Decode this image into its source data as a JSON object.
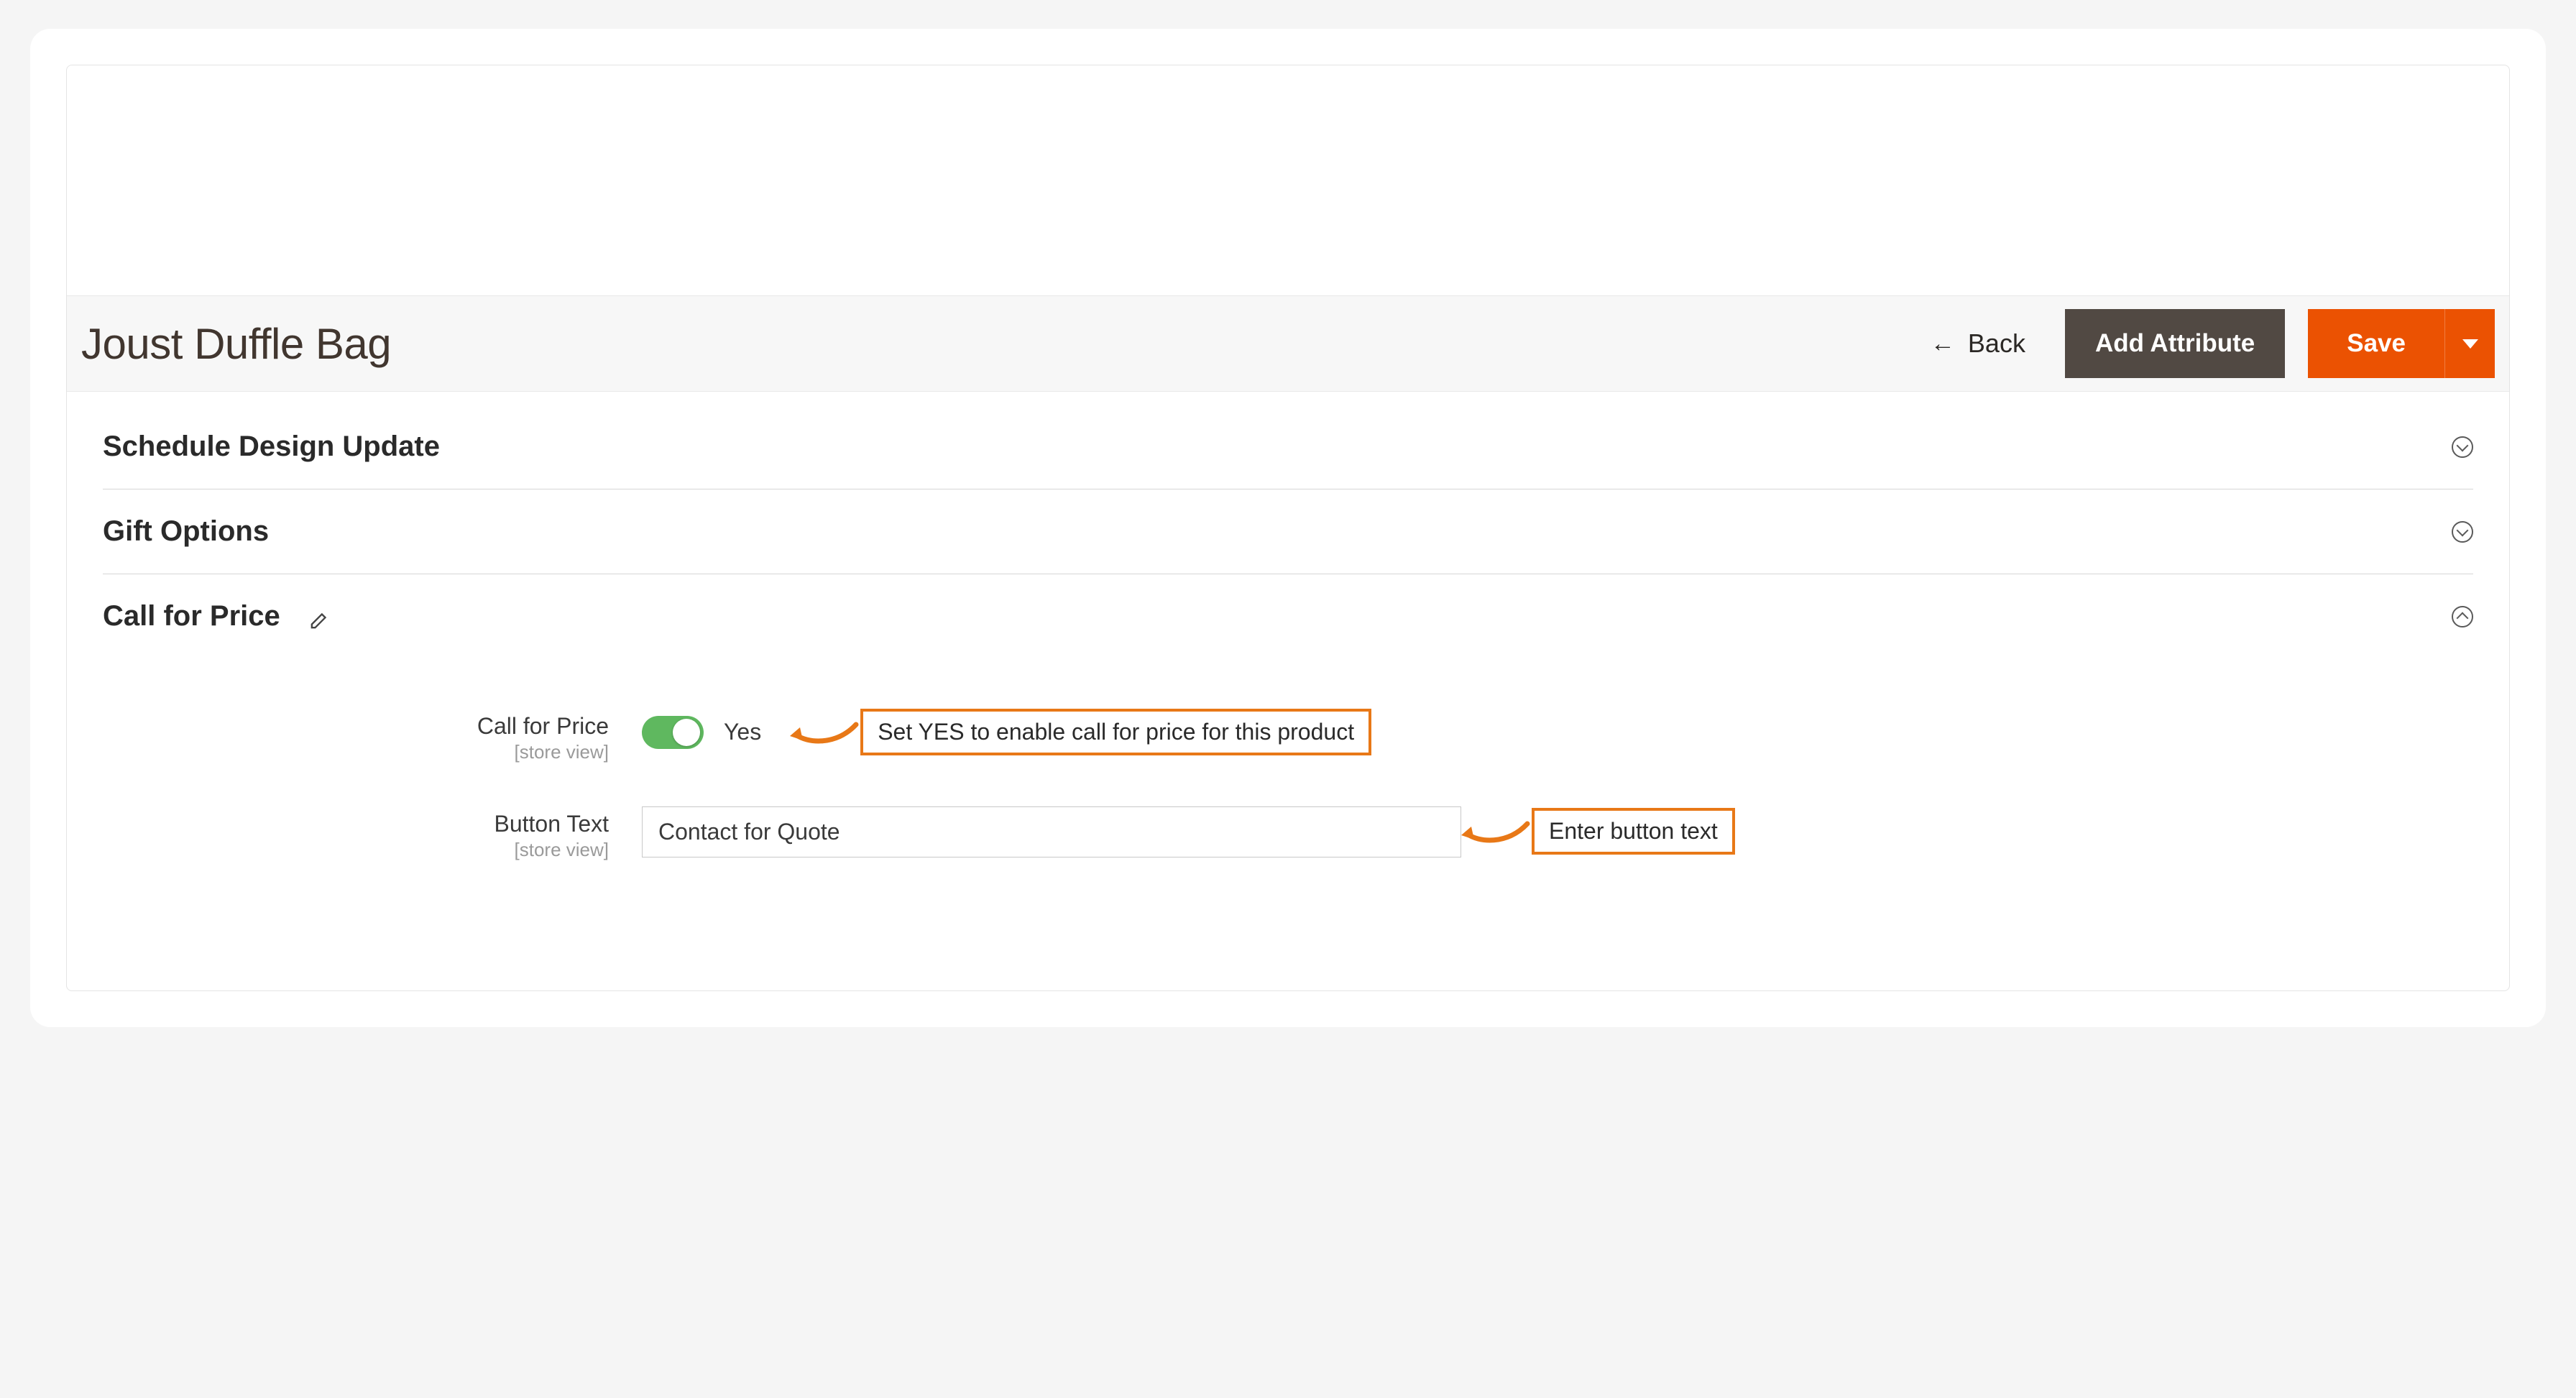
{
  "header": {
    "title": "Joust Duffle Bag",
    "back_label": "Back",
    "add_attribute_label": "Add Attribute",
    "save_label": "Save"
  },
  "sections": {
    "schedule_design_update": "Schedule Design Update",
    "gift_options": "Gift Options",
    "call_for_price": "Call for Price"
  },
  "fields": {
    "call_for_price": {
      "label": "Call for Price",
      "scope": "[store view]",
      "value_label": "Yes"
    },
    "button_text": {
      "label": "Button Text",
      "scope": "[store view]",
      "value": "Contact for Quote"
    }
  },
  "callouts": {
    "enable": "Set YES to enable call for price for this product",
    "button_text": "Enter button text"
  },
  "colors": {
    "accent_orange": "#eb5202",
    "callout_border": "#e87817",
    "toggle_on": "#5fb85f"
  }
}
